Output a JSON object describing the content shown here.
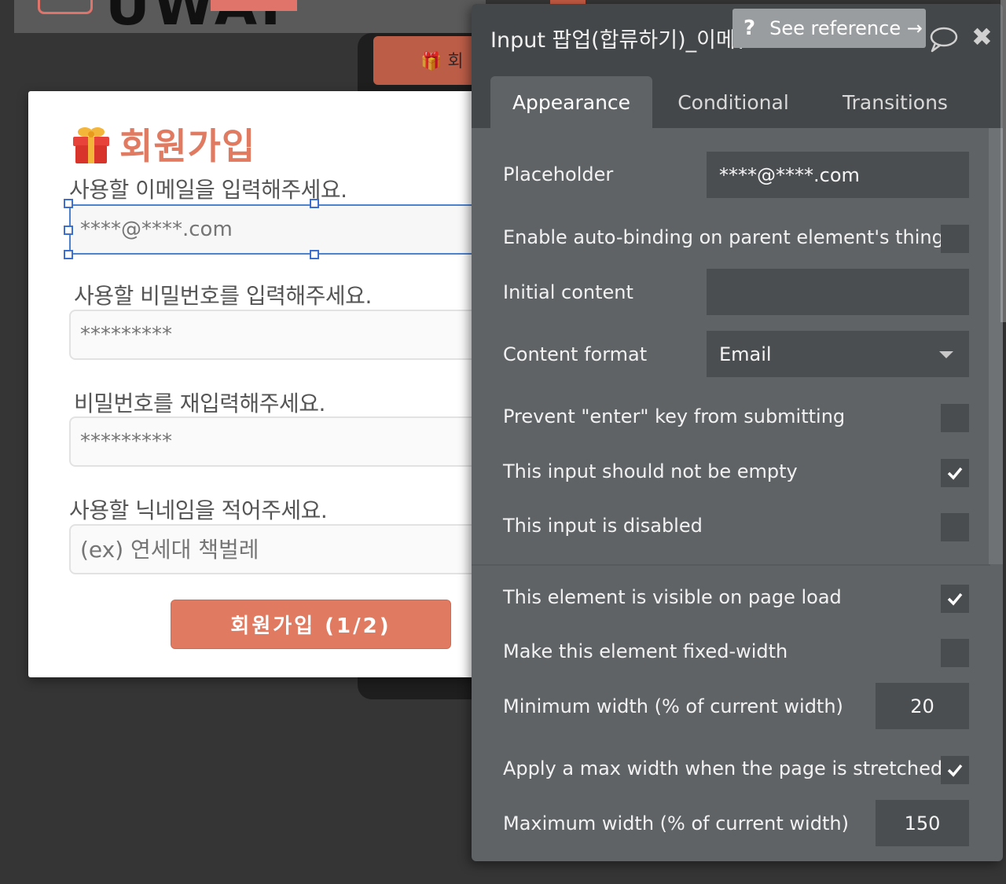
{
  "popup": {
    "title": "회원가입",
    "email_label": "사용할 이메일을 입력해주세요.",
    "email_placeholder": "****@****.com",
    "password_label": "사용할 비밀번호를 입력해주세요.",
    "password_placeholder": "*********",
    "password_confirm_label": "비밀번호를 재입력해주세요.",
    "password_confirm_placeholder": "*********",
    "nickname_label": "사용할 닉네임을 적어주세요.",
    "nickname_placeholder": "(ex) 연세대 책벌레",
    "submit_label": "회원가입 (1/2)"
  },
  "editor": {
    "title": "Input 팝업(합류하기)_이메일",
    "see_reference": "See reference →",
    "tabs": [
      "Appearance",
      "Conditional",
      "Transitions"
    ],
    "placeholder_label": "Placeholder",
    "placeholder_value": "****@****.com",
    "autobinding_label": "Enable auto-binding on parent element's thing",
    "initial_content_label": "Initial content",
    "initial_content_value": "",
    "content_format_label": "Content format",
    "content_format_value": "Email",
    "prevent_enter_label": "Prevent \"enter\" key from submitting",
    "not_empty_label": "This input should not be empty",
    "disabled_label": "This input is disabled",
    "visible_label": "This element is visible on page load",
    "fixed_width_label": "Make this element fixed-width",
    "min_width_label": "Minimum width (% of current width)",
    "min_width_value": "20",
    "max_width_apply_label": "Apply a max width when the page is stretched",
    "max_width_label": "Maximum width (% of current width)",
    "max_width_value": "150"
  },
  "background": {
    "logo_text": "UWAI"
  },
  "colors": {
    "accent": "#e07b62",
    "editor_bg": "#5f6366",
    "editor_header": "#444749",
    "selection": "#3d6fd0"
  },
  "checkbox_states": {
    "autobinding": false,
    "prevent_enter": false,
    "not_empty": true,
    "disabled": false,
    "visible": true,
    "fixed_width": false,
    "max_width_apply": true
  }
}
